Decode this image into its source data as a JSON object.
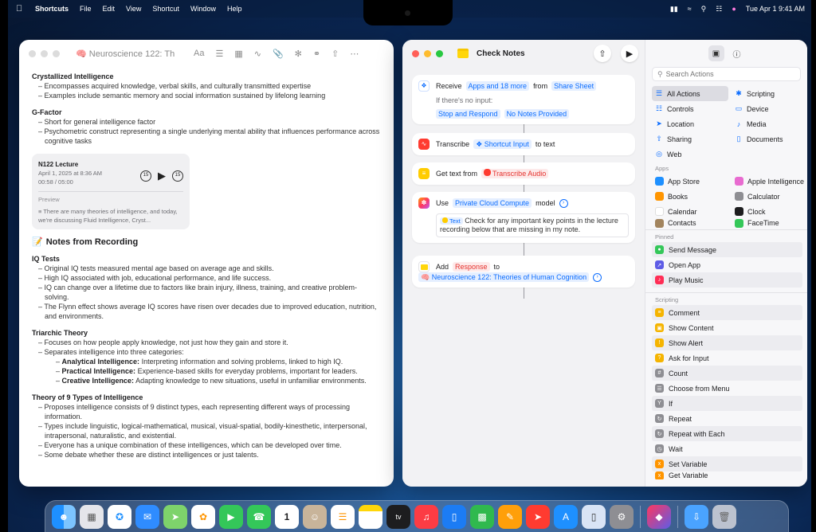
{
  "menubar": {
    "app": "Shortcuts",
    "items": [
      "File",
      "Edit",
      "View",
      "Shortcut",
      "Window",
      "Help"
    ],
    "clock": "Tue Apr 1  9:41 AM"
  },
  "notes": {
    "title": "Neuroscience 122: Th",
    "crystallized": {
      "heading": "Crystallized Intelligence",
      "items": [
        "Encompasses acquired knowledge, verbal skills, and culturally transmitted expertise",
        "Examples include semantic memory and social information sustained by lifelong learning"
      ]
    },
    "gfactor": {
      "heading": "G-Factor",
      "items": [
        "Short for general intelligence factor",
        "Psychometric construct representing a single underlying mental ability that influences performance across cognitive tasks"
      ]
    },
    "audio": {
      "name": "N122 Lecture",
      "date": "April 1, 2025 at 8:36 AM",
      "time": "00:58 / 05:00",
      "preview_label": "Preview",
      "preview": "There are many theories of intelligence, and today, we're discussing Fluid Intelligence, Cryst..."
    },
    "recording_title": "Notes from Recording",
    "iq": {
      "heading": "IQ Tests",
      "items": [
        "Original IQ tests measured mental age based on average age and skills.",
        "High IQ associated with job, educational performance, and life success.",
        "IQ can change over a lifetime due to factors like brain injury, illness, training, and creative problem-solving.",
        "The Flynn effect shows average IQ scores have risen over decades due to improved education, nutrition, and environments."
      ]
    },
    "triarchic": {
      "heading": "Triarchic Theory",
      "items": [
        "Focuses on how people apply knowledge, not just how they gain and store it.",
        "Separates intelligence into three categories:"
      ],
      "sub": [
        {
          "term": "Analytical Intelligence:",
          "desc": "Interpreting information and solving problems, linked to high IQ."
        },
        {
          "term": "Practical Intelligence:",
          "desc": "Experience-based skills for everyday problems, important for leaders."
        },
        {
          "term": "Creative Intelligence:",
          "desc": "Adapting knowledge to new situations, useful in unfamiliar environments."
        }
      ]
    },
    "nine": {
      "heading": "Theory of 9 Types of Intelligence",
      "items": [
        "Proposes intelligence consists of 9 distinct types, each representing different ways of processing information.",
        "Types include linguistic, logical-mathematical, musical, visual-spatial, bodily-kinesthetic, interpersonal, intrapersonal, naturalistic, and existential.",
        "Everyone has a unique combination of these intelligences, which can be developed over time.",
        "Some debate whether these are distinct intelligences or just talents."
      ]
    }
  },
  "shortcut": {
    "title": "Check Notes",
    "receive": {
      "verb": "Receive",
      "input": "Apps and 18 more",
      "from": "from",
      "source": "Share Sheet",
      "no_input": "If there's no input:",
      "stop": "Stop and Respond",
      "response": "No Notes Provided"
    },
    "transcribe": {
      "verb": "Transcribe",
      "input": "Shortcut Input",
      "suffix": "to text"
    },
    "gettext": {
      "verb": "Get text from",
      "input": "Transcribe Audio"
    },
    "use": {
      "verb": "Use",
      "model": "Private Cloud Compute",
      "suffix": "model",
      "tag": "Text",
      "prompt": "Check for any important key points in the lecture recording below that are missing in my note."
    },
    "add": {
      "verb": "Add",
      "input": "Response",
      "to": "to",
      "target": "Neuroscience 122: Theories of Human Cognition"
    }
  },
  "library": {
    "search_placeholder": "Search Actions",
    "categories": [
      {
        "label": "All Actions",
        "icon": "list-icon"
      },
      {
        "label": "Scripting",
        "icon": "scripting-icon"
      },
      {
        "label": "Controls",
        "icon": "controls-icon"
      },
      {
        "label": "Device",
        "icon": "device-icon"
      },
      {
        "label": "Location",
        "icon": "location-icon"
      },
      {
        "label": "Media",
        "icon": "music-icon"
      },
      {
        "label": "Sharing",
        "icon": "sharing-icon"
      },
      {
        "label": "Documents",
        "icon": "document-icon"
      },
      {
        "label": "Web",
        "icon": "web-icon"
      }
    ],
    "apps_label": "Apps",
    "apps": [
      {
        "label": "App Store",
        "color": "#1e90ff"
      },
      {
        "label": "Apple Intelligence",
        "color": "#e86bd0"
      },
      {
        "label": "Books",
        "color": "#ff9500"
      },
      {
        "label": "Calculator",
        "color": "#8e8e93"
      },
      {
        "label": "Calendar",
        "color": "#ffffff"
      },
      {
        "label": "Clock",
        "color": "#1d1d1f"
      },
      {
        "label": "Contacts",
        "color": "#a2845e"
      },
      {
        "label": "FaceTime",
        "color": "#34c759"
      }
    ],
    "pinned_label": "Pinned",
    "pinned": [
      {
        "label": "Send Message",
        "color": "#34c759"
      },
      {
        "label": "Open App",
        "color": "#5e5ce6"
      },
      {
        "label": "Play Music",
        "color": "#ff2d55"
      }
    ],
    "scripting_label": "Scripting",
    "scripting": [
      {
        "label": "Comment",
        "color": "#f5b400"
      },
      {
        "label": "Show Content",
        "color": "#f5b400"
      },
      {
        "label": "Show Alert",
        "color": "#f5b400"
      },
      {
        "label": "Ask for Input",
        "color": "#f5b400"
      },
      {
        "label": "Count",
        "color": "#8e8e93"
      },
      {
        "label": "Choose from Menu",
        "color": "#8e8e93"
      },
      {
        "label": "If",
        "color": "#8e8e93"
      },
      {
        "label": "Repeat",
        "color": "#8e8e93"
      },
      {
        "label": "Repeat with Each",
        "color": "#8e8e93"
      },
      {
        "label": "Wait",
        "color": "#8e8e93"
      },
      {
        "label": "Set Variable",
        "color": "#ff9500"
      },
      {
        "label": "Get Variable",
        "color": "#ff9500"
      }
    ]
  },
  "dock": [
    "Finder",
    "Launchpad",
    "Safari",
    "Mail",
    "Maps",
    "Photos",
    "FaceTime",
    "Phone",
    "Calendar",
    "Contacts",
    "Reminders",
    "Notes",
    "TV",
    "Music",
    "Keynote",
    "Numbers",
    "Pages",
    "Rocket",
    "App Store",
    "iPhone Mirroring",
    "System Settings",
    "Shortcuts",
    "Downloads",
    "Trash"
  ],
  "calendar_day": "1",
  "tv_label": "tv"
}
